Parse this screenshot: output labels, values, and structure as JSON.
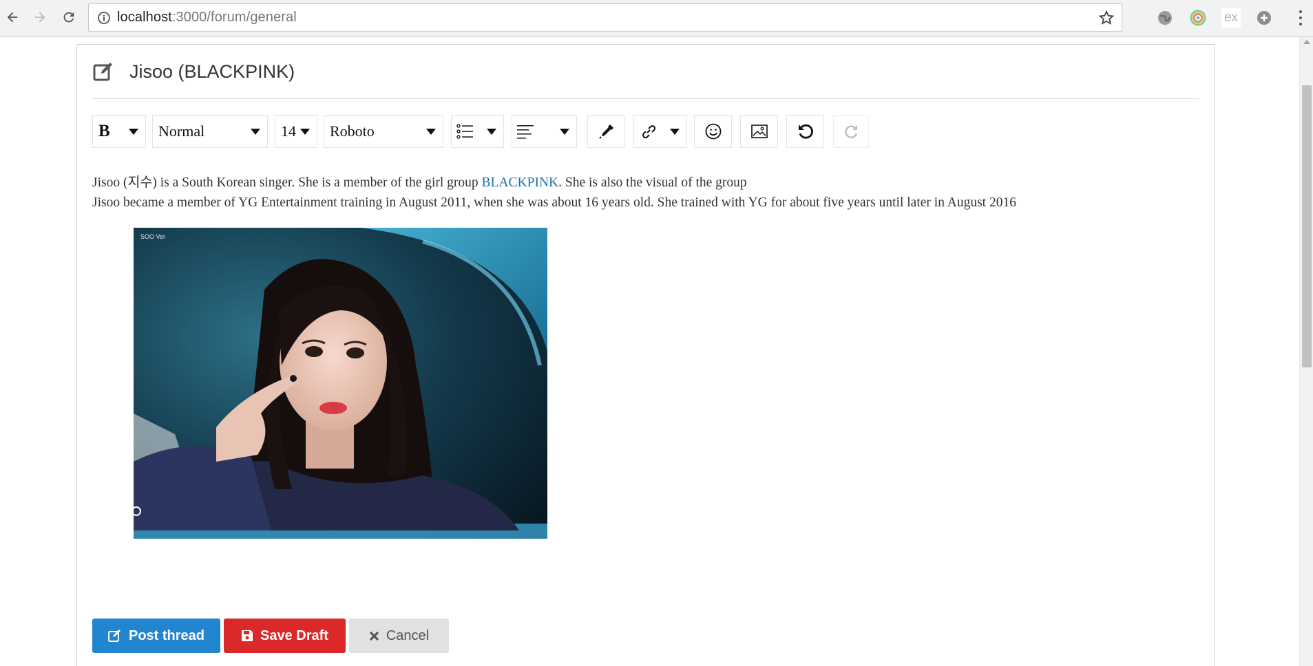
{
  "browser": {
    "url_host": "localhost",
    "url_rest": ":3000/forum/general",
    "extensions": [
      "globe-extension-icon",
      "color-picker-extension-icon",
      "ex-extension-icon",
      "grid-extension-icon"
    ],
    "ext_label": "ex"
  },
  "panel": {
    "title": "Jisoo (BLACKPINK)"
  },
  "toolbar": {
    "bold_label": "B",
    "block_type": "Normal",
    "font_size": "14",
    "font_family": "Roboto"
  },
  "editor": {
    "p1_before": "Jisoo (지수) is a South Korean singer. She is a member of the girl group ",
    "p1_link": "BLACKPINK",
    "p1_after": ". She is also the visual of the group",
    "p2": "Jisoo became a member of YG Entertainment training in August 2011, when she was about 16 years old. She trained with YG for about five years until later in August 2016",
    "photo_watermark": "SOO Ver"
  },
  "actions": {
    "post_label": "Post thread",
    "draft_label": "Save Draft",
    "cancel_label": "Cancel"
  },
  "colors": {
    "post": "#2185d0",
    "draft": "#db2828",
    "cancel": "#e0e1e2",
    "link": "#1a6fa8"
  }
}
